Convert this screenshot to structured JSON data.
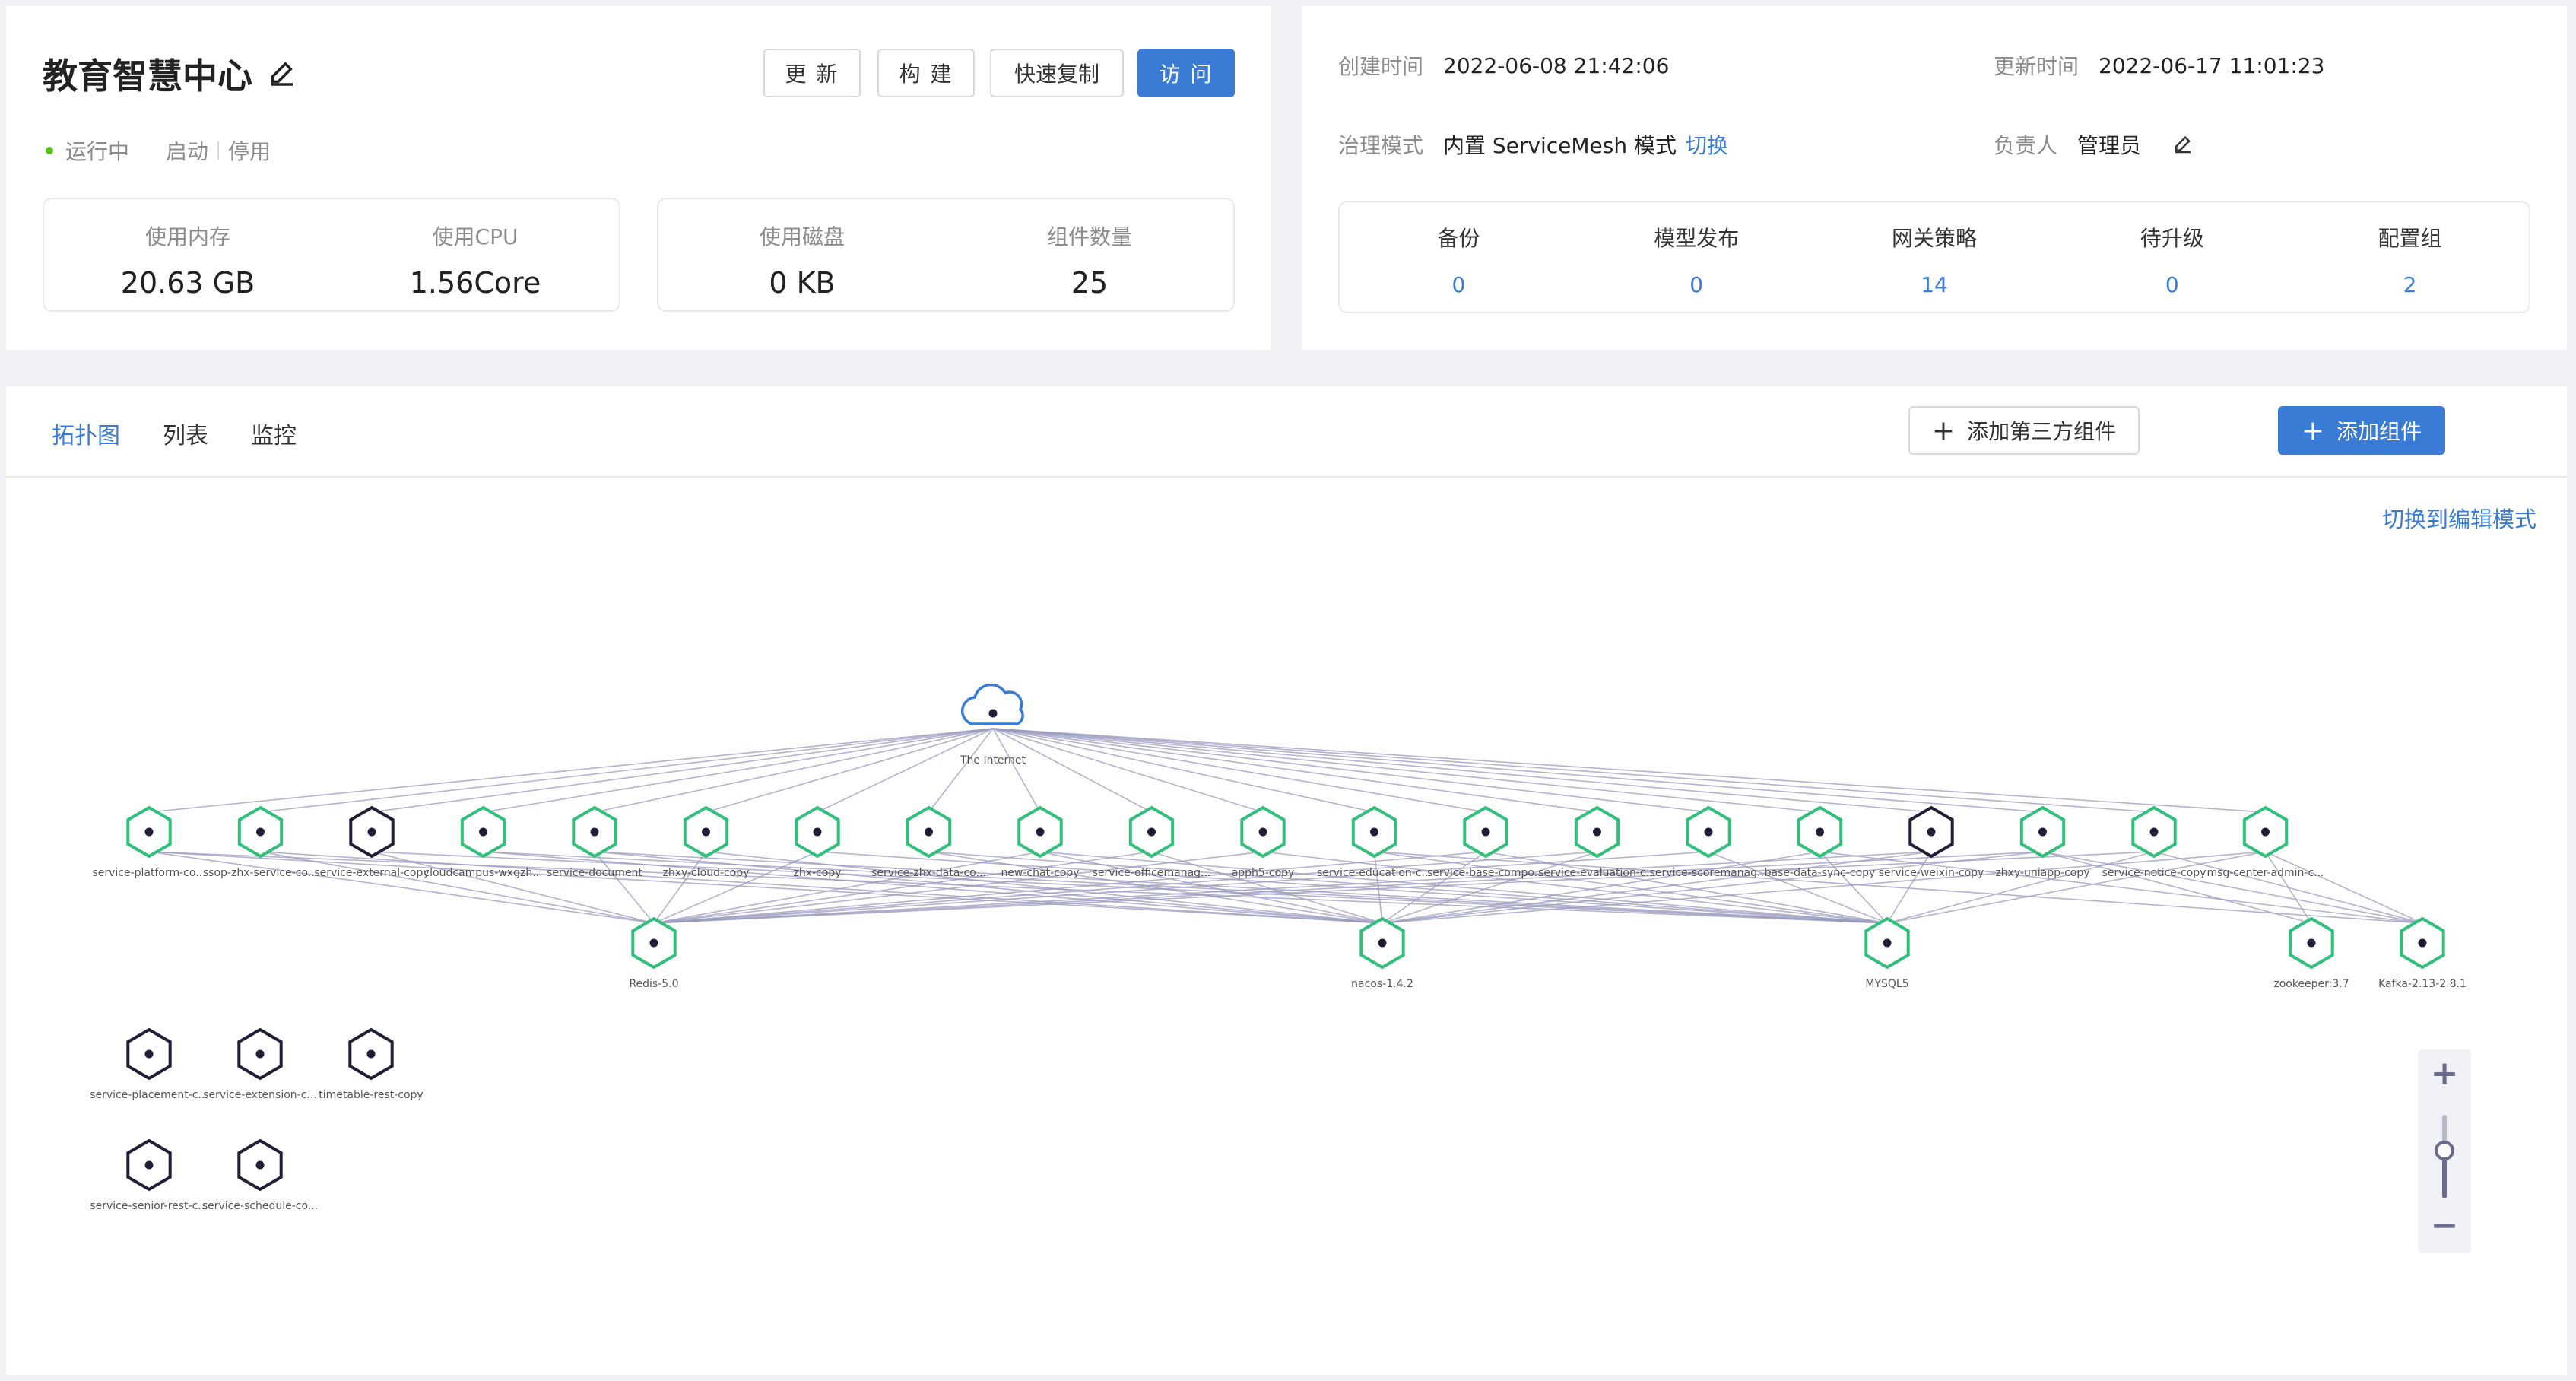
{
  "app": {
    "title": "教育智慧中心",
    "buttons": {
      "update": "更 新",
      "build": "构 建",
      "quick_copy": "快速复制",
      "visit": "访 问"
    },
    "status": "运行中",
    "start": "启动",
    "stop": "停用",
    "stats": [
      {
        "label": "使用内存",
        "value": "20.63 GB"
      },
      {
        "label": "使用CPU",
        "value": "1.56Core"
      },
      {
        "label": "使用磁盘",
        "value": "0 KB"
      },
      {
        "label": "组件数量",
        "value": "25"
      }
    ]
  },
  "meta": {
    "created_label": "创建时间",
    "created_value": "2022-06-08 21:42:06",
    "updated_label": "更新时间",
    "updated_value": "2022-06-17 11:01:23",
    "governance_label": "治理模式",
    "governance_value": "内置 ServiceMesh 模式",
    "switch_link": "切换",
    "owner_label": "负责人",
    "owner_value": "管理员"
  },
  "metrics": [
    {
      "label": "备份",
      "value": "0"
    },
    {
      "label": "模型发布",
      "value": "0"
    },
    {
      "label": "网关策略",
      "value": "14"
    },
    {
      "label": "待升级",
      "value": "0"
    },
    {
      "label": "配置组",
      "value": "2"
    }
  ],
  "tabs": [
    "拓扑图",
    "列表",
    "监控"
  ],
  "actions": {
    "add_third_party": "添加第三方组件",
    "add_component": "添加组件"
  },
  "switch_edit": "切换到编辑模式",
  "topology": {
    "internet": "The Internet",
    "row1": [
      "service-platform-co...",
      "ssop-zhx-service-co...",
      "service-external-copy",
      "cloudcampus-wxgzh...",
      "service-document",
      "zhxy-cloud-copy",
      "zhx-copy",
      "service-zhx-data-co...",
      "new-chat-copy",
      "service-officemanag...",
      "apph5-copy",
      "service-education-c...",
      "service-base-compo...",
      "service-evaluation-c...",
      "service-scoremanag...",
      "base-data-sync-copy",
      "service-weixin-copy",
      "zhxy-uniapp-copy",
      "service-notice-copy",
      "msg-center-admin-c..."
    ],
    "row1_dark": [
      2,
      16
    ],
    "row2": [
      "Redis-5.0",
      "nacos-1.4.2",
      "MYSQL5",
      "zookeeper:3.7",
      "Kafka-2.13-2.8.1"
    ],
    "isolated": [
      "service-placement-c...",
      "service-extension-c...",
      "timetable-rest-copy",
      "service-senior-rest-c...",
      "service-schedule-co..."
    ]
  },
  "colors": {
    "primary": "#3a7bd5",
    "running": "#52c41a",
    "node_green": "#2fc07a",
    "node_dark": "#1f1f3a",
    "edge": "#9a9abf"
  }
}
